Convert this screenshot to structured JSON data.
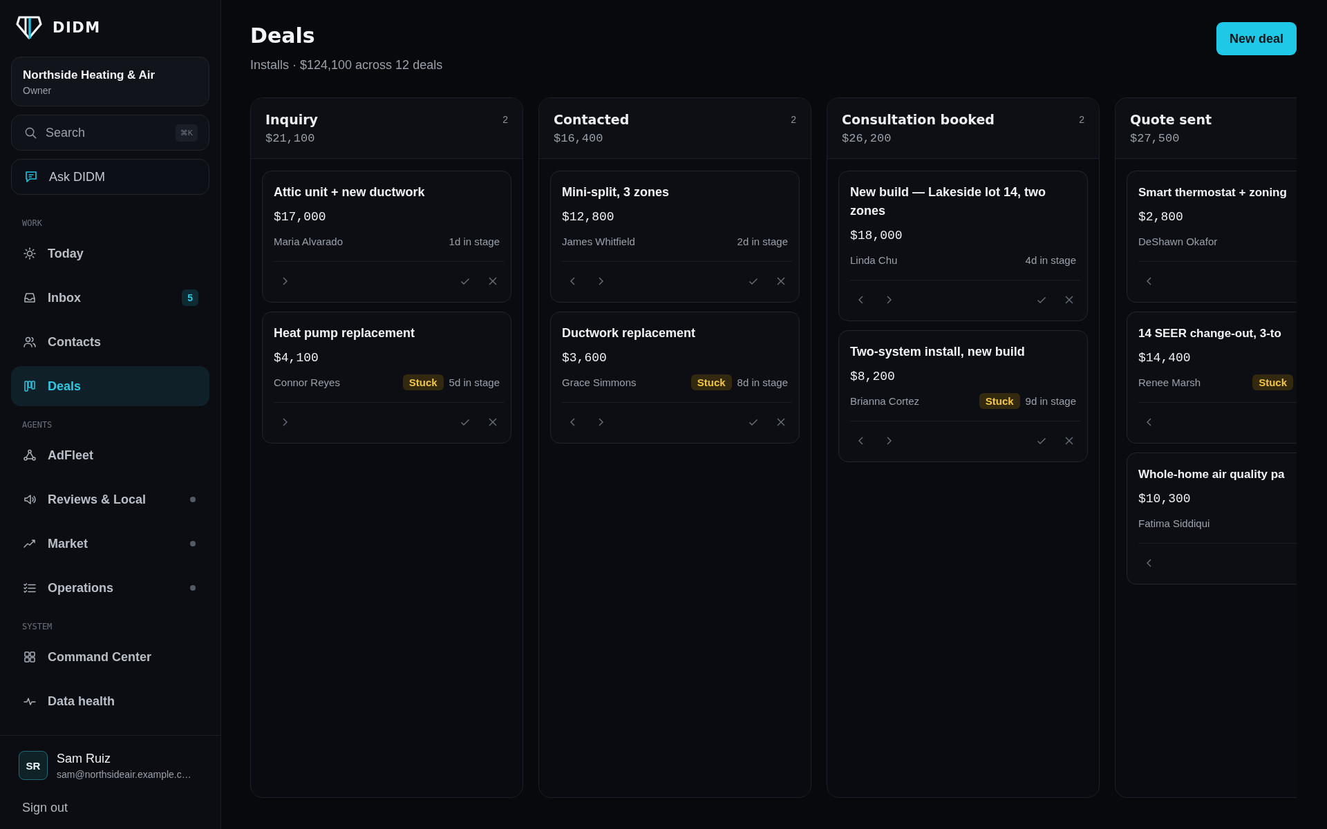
{
  "brand": {
    "name": "DIDM"
  },
  "workspace": {
    "name": "Northside Heating & Air",
    "role": "Owner"
  },
  "search": {
    "placeholder": "Search",
    "shortcut": "⌘K"
  },
  "assistant": {
    "label": "Ask DIDM"
  },
  "nav_sections": [
    {
      "title": "WORK",
      "items": [
        {
          "label": "Today",
          "selected": false,
          "dot": false
        },
        {
          "label": "Inbox",
          "selected": false,
          "dot": false,
          "badge": "5"
        },
        {
          "label": "Contacts",
          "selected": false,
          "dot": false
        },
        {
          "label": "Deals",
          "selected": true,
          "dot": false
        }
      ]
    },
    {
      "title": "AGENTS",
      "items": [
        {
          "label": "AdFleet",
          "selected": false,
          "dot": false
        },
        {
          "label": "Reviews & Local",
          "selected": false,
          "dot": true
        },
        {
          "label": "Market",
          "selected": false,
          "dot": true
        },
        {
          "label": "Operations",
          "selected": false,
          "dot": true
        }
      ]
    },
    {
      "title": "SYSTEM",
      "items": [
        {
          "label": "Command Center",
          "selected": false,
          "dot": false
        },
        {
          "label": "Data health",
          "selected": false,
          "dot": false
        }
      ]
    }
  ],
  "user": {
    "initials": "SR",
    "name": "Sam Ruiz",
    "email": "sam@northsideair.example.c…",
    "sign_out": "Sign out"
  },
  "page": {
    "title": "Deals",
    "subtitle": "Installs · $124,100 across 12 deals",
    "primary_action": "New deal"
  },
  "columns": [
    {
      "name": "Inquiry",
      "total": "$21,100",
      "count": "2",
      "partial": false,
      "cards": [
        {
          "title": "Attic unit + new ductwork",
          "amount": "$17,000",
          "contact": "Maria Alvarado",
          "age": "1d in stage",
          "back": false,
          "forward": true,
          "actions": true
        },
        {
          "title": "Heat pump replacement",
          "amount": "$4,100",
          "contact": "Connor Reyes",
          "badge": "Stuck",
          "age": "5d in stage",
          "back": false,
          "forward": true,
          "actions": true
        }
      ]
    },
    {
      "name": "Contacted",
      "total": "$16,400",
      "count": "2",
      "partial": false,
      "cards": [
        {
          "title": "Mini-split, 3 zones",
          "amount": "$12,800",
          "contact": "James Whitfield",
          "age": "2d in stage",
          "back": true,
          "forward": true,
          "actions": true
        },
        {
          "title": "Ductwork replacement",
          "amount": "$3,600",
          "contact": "Grace Simmons",
          "badge": "Stuck",
          "age": "8d in stage",
          "back": true,
          "forward": true,
          "actions": true
        }
      ]
    },
    {
      "name": "Consultation booked",
      "total": "$26,200",
      "count": "2",
      "partial": false,
      "cards": [
        {
          "title": "New build — Lakeside lot 14, two zones",
          "amount": "$18,000",
          "contact": "Linda Chu",
          "age": "4d in stage",
          "back": true,
          "forward": true,
          "actions": true
        },
        {
          "title": "Two-system install, new build",
          "amount": "$8,200",
          "contact": "Brianna Cortez",
          "badge": "Stuck",
          "age": "9d in stage",
          "back": true,
          "forward": true,
          "actions": true
        }
      ]
    },
    {
      "name": "Quote sent",
      "total": "$27,500",
      "partial": true,
      "cards": [
        {
          "title": "Smart thermostat + zoning",
          "amount": "$2,800",
          "contact": "DeShawn Okafor",
          "back": true,
          "forward": false,
          "actions": false
        },
        {
          "title": "14 SEER change-out, 3-to",
          "amount": "$14,400",
          "contact": "Renee Marsh",
          "badge": "Stuck",
          "back": true,
          "forward": false,
          "actions": false
        },
        {
          "title": "Whole-home air quality pa",
          "amount": "$10,300",
          "contact": "Fatima Siddiqui",
          "back": true,
          "forward": false,
          "actions": false
        }
      ]
    }
  ]
}
